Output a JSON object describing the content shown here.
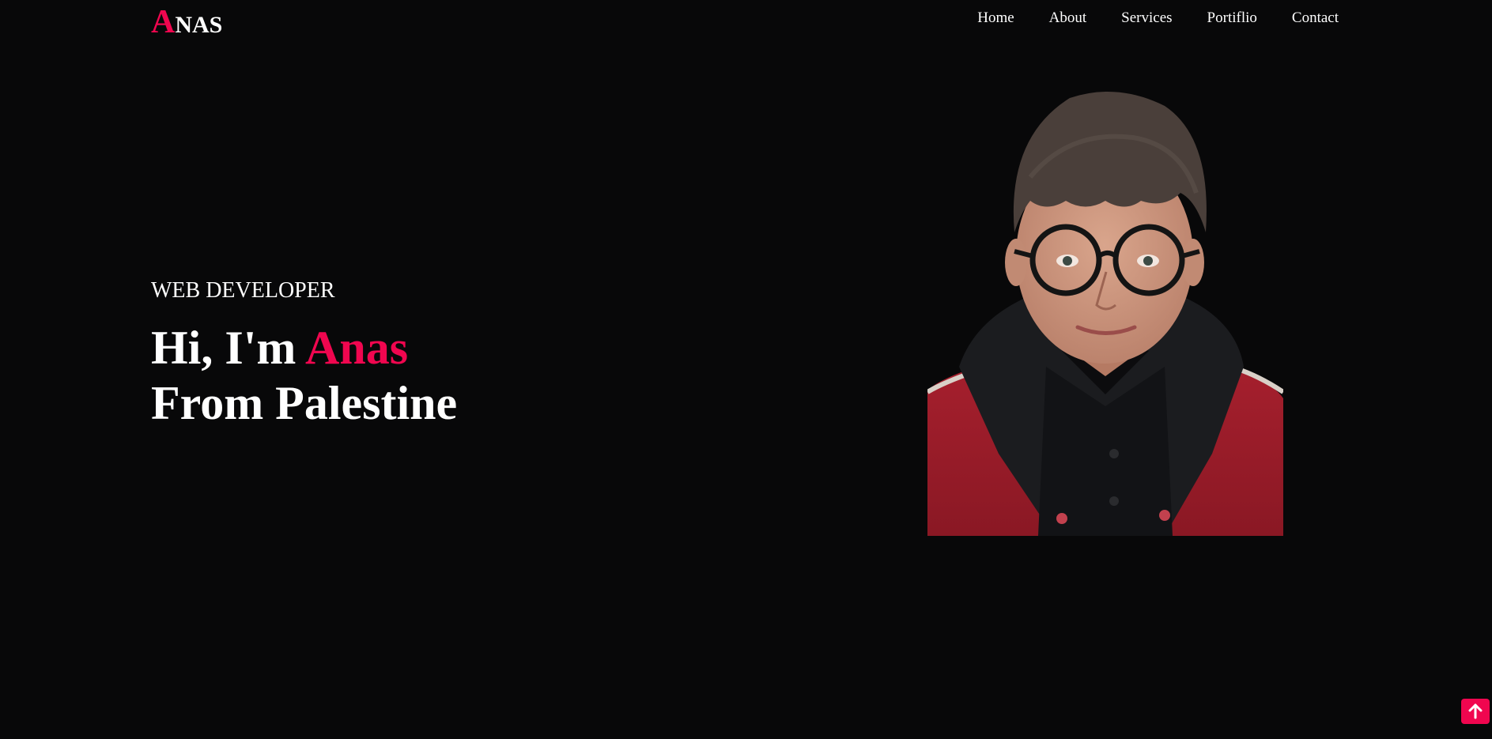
{
  "brand": {
    "logo_first": "A",
    "logo_rest": "NAS",
    "accent_color": "#f0064f",
    "background_color": "#080809"
  },
  "nav": {
    "items": [
      {
        "label": "Home"
      },
      {
        "label": "About"
      },
      {
        "label": "Services"
      },
      {
        "label": "Portiflio"
      },
      {
        "label": "Contact"
      }
    ]
  },
  "hero": {
    "subtitle": "WEB DEVELOPER",
    "greeting": "Hi, I'm",
    "name": "Anas",
    "origin": "From Palestine"
  },
  "portrait": {
    "description_icon": "profile-photo"
  },
  "back_to_top": {
    "icon": "arrow-up-icon"
  }
}
